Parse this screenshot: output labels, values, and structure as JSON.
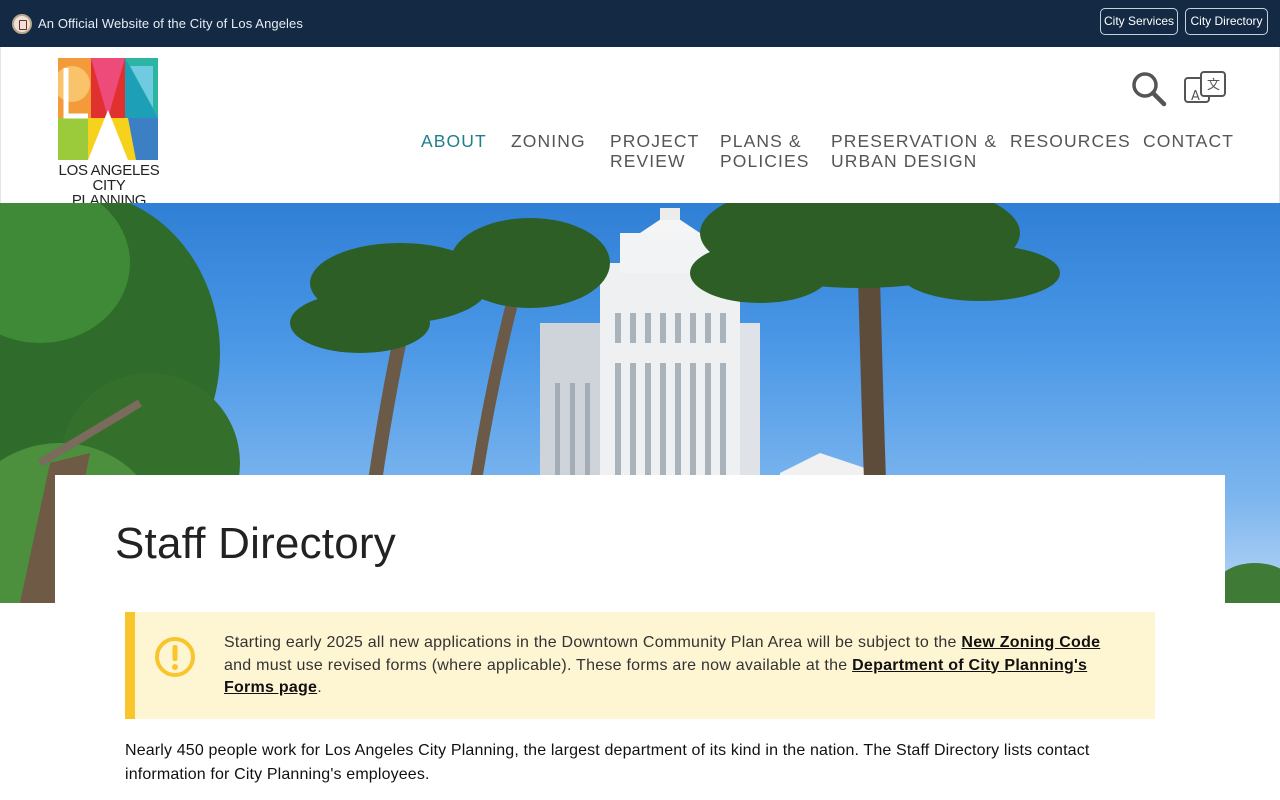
{
  "topbar": {
    "official_text": "An Official Website of the City of Los Angeles",
    "city_services": "City Services",
    "city_directory": "City Directory"
  },
  "logo": {
    "line1": "LOS ANGELES",
    "line2": "CITY PLANNING"
  },
  "header": {
    "icons": [
      "search-icon",
      "translate-icon"
    ]
  },
  "nav": [
    {
      "line1": "ABOUT",
      "line2": "",
      "active": true
    },
    {
      "line1": "ZONING",
      "line2": ""
    },
    {
      "line1": "PROJECT",
      "line2": "REVIEW"
    },
    {
      "line1": "PLANS &",
      "line2": "POLICIES"
    },
    {
      "line1": "PRESERVATION &",
      "line2": "URBAN DESIGN"
    },
    {
      "line1": "RESOURCES",
      "line2": ""
    },
    {
      "line1": "CONTACT",
      "line2": ""
    }
  ],
  "colors": {
    "topbar_bg": "#142a44",
    "nav_active": "#1d7f8c",
    "notice_bg": "#fef5d3",
    "notice_accent": "#f8c52d"
  },
  "page": {
    "title": "Staff Directory"
  },
  "notice": {
    "icon": "exclamation-circle-icon",
    "text_before": "Starting early 2025 all new applications in the Downtown Community Plan Area will be subject to the ",
    "link1": "New Zoning Code",
    "text_middle": " and must use revised forms (where applicable). These forms are now available at the ",
    "link2": "Department of City Planning's Forms page",
    "text_after": "."
  },
  "intro": {
    "text": "Nearly 450 people work for Los Angeles City Planning, the largest department of its kind in the nation. The Staff Directory lists contact information for City Planning's employees."
  }
}
